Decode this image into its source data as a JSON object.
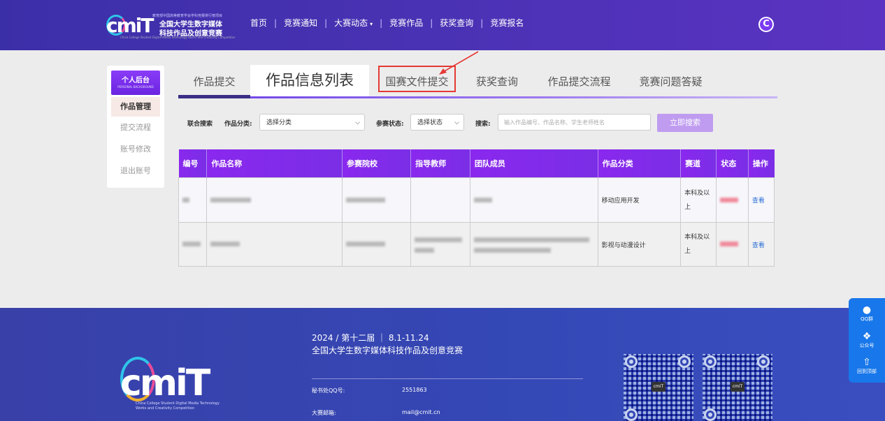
{
  "header": {
    "logo_mark": "cmiT",
    "logo_line1": "教育部中国高等教育学会学科竞赛排行榜项目",
    "logo_line2": "全国大学生数字媒体",
    "logo_line3": "科技作品及创意竞赛",
    "logo_sub": "China College Student Digital Media Technology Works and Creativity Competition",
    "nav": [
      "首页",
      "竞赛通知",
      "大赛动态",
      "竞赛作品",
      "获奖查询",
      "竞赛报名"
    ],
    "nav_caret": "▾",
    "user_icon": "C"
  },
  "sidebar": {
    "title": "个人后台",
    "subtitle": "PERSONAL BACKGROUND",
    "items": [
      "作品管理",
      "提交流程",
      "账号修改",
      "退出账号"
    ]
  },
  "tabs": [
    "作品提交",
    "作品信息列表",
    "国赛文件提交",
    "获奖查询",
    "作品提交流程",
    "竞赛问题答疑"
  ],
  "filters": {
    "joint_label": "联合搜索",
    "category_label": "作品分类:",
    "category_value": "选择分类",
    "status_label": "参赛状态:",
    "status_value": "选择状态",
    "search_label": "搜索:",
    "search_placeholder": "输入作品编号、作品名称、学生老师姓名",
    "search_button": "立即搜索"
  },
  "table": {
    "columns": [
      "编号",
      "作品名称",
      "参赛院校",
      "指导教师",
      "团队成员",
      "作品分类",
      "赛道",
      "状态",
      "操作"
    ],
    "rows": [
      {
        "category": "移动应用开发",
        "track": "本科及以上",
        "action": "查看"
      },
      {
        "category": "影视与动漫设计",
        "track": "本科及以上",
        "action": "查看"
      }
    ]
  },
  "footer": {
    "logo_mark": "cmiT",
    "logo_sub1": "China College Student Digital Media Technology",
    "logo_sub2": "Works and Creativity Competition",
    "line1": "2024 / 第十二届 ｜ 8.1-11.24",
    "line2": "全国大学生数字媒体科技作品及创意竞赛",
    "qq_label": "秘书处QQ号:",
    "qq_value": "2551863",
    "mail_label": "大赛邮箱:",
    "mail_value": "mail@cmit.cn"
  },
  "float_bar": {
    "items": [
      {
        "icon": "qq-icon",
        "label": "QQ群"
      },
      {
        "icon": "chat-icon",
        "label": "公众号"
      },
      {
        "icon": "arrow-up-icon",
        "label": "回到顶部"
      }
    ]
  },
  "colors": {
    "header_bg": "#4a32b4",
    "accent_purple": "#8a28ee",
    "highlight_red": "#e53935",
    "footer_bg": "#3448b6",
    "float_blue": "#1877ea"
  }
}
